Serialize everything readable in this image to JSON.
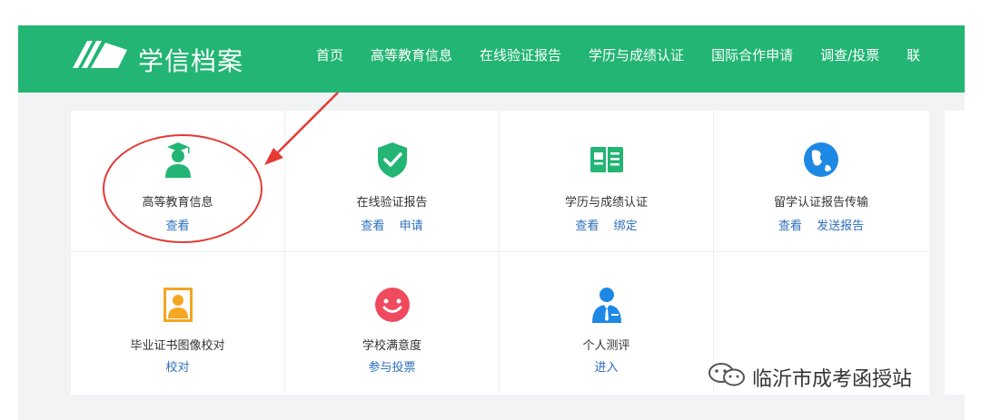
{
  "header": {
    "brand": "学信档案",
    "nav": [
      "首页",
      "高等教育信息",
      "在线验证报告",
      "学历与成绩认证",
      "国际合作申请",
      "调查/投票",
      "联"
    ]
  },
  "cards": [
    {
      "title": "高等教育信息",
      "links": [
        "查看"
      ],
      "icon": "graduate-icon",
      "color": "#22b573"
    },
    {
      "title": "在线验证报告",
      "links": [
        "查看",
        "申请"
      ],
      "icon": "shield-check-icon",
      "color": "#22b573"
    },
    {
      "title": "学历与成绩认证",
      "links": [
        "查看",
        "绑定"
      ],
      "icon": "book-icon",
      "color": "#22b573"
    },
    {
      "title": "留学认证报告传输",
      "links": [
        "查看",
        "发送报告"
      ],
      "icon": "globe-icon",
      "color": "#1e88e5"
    },
    {
      "title": "毕业证书图像校对",
      "links": [
        "校对"
      ],
      "icon": "id-photo-icon",
      "color": "#f5a623"
    },
    {
      "title": "学校满意度",
      "links": [
        "参与投票"
      ],
      "icon": "smile-icon",
      "color": "#ef4a5e"
    },
    {
      "title": "个人测评",
      "links": [
        "进入"
      ],
      "icon": "person-tie-icon",
      "color": "#1e88e5"
    }
  ],
  "watermark": "临沂市成考函授站"
}
